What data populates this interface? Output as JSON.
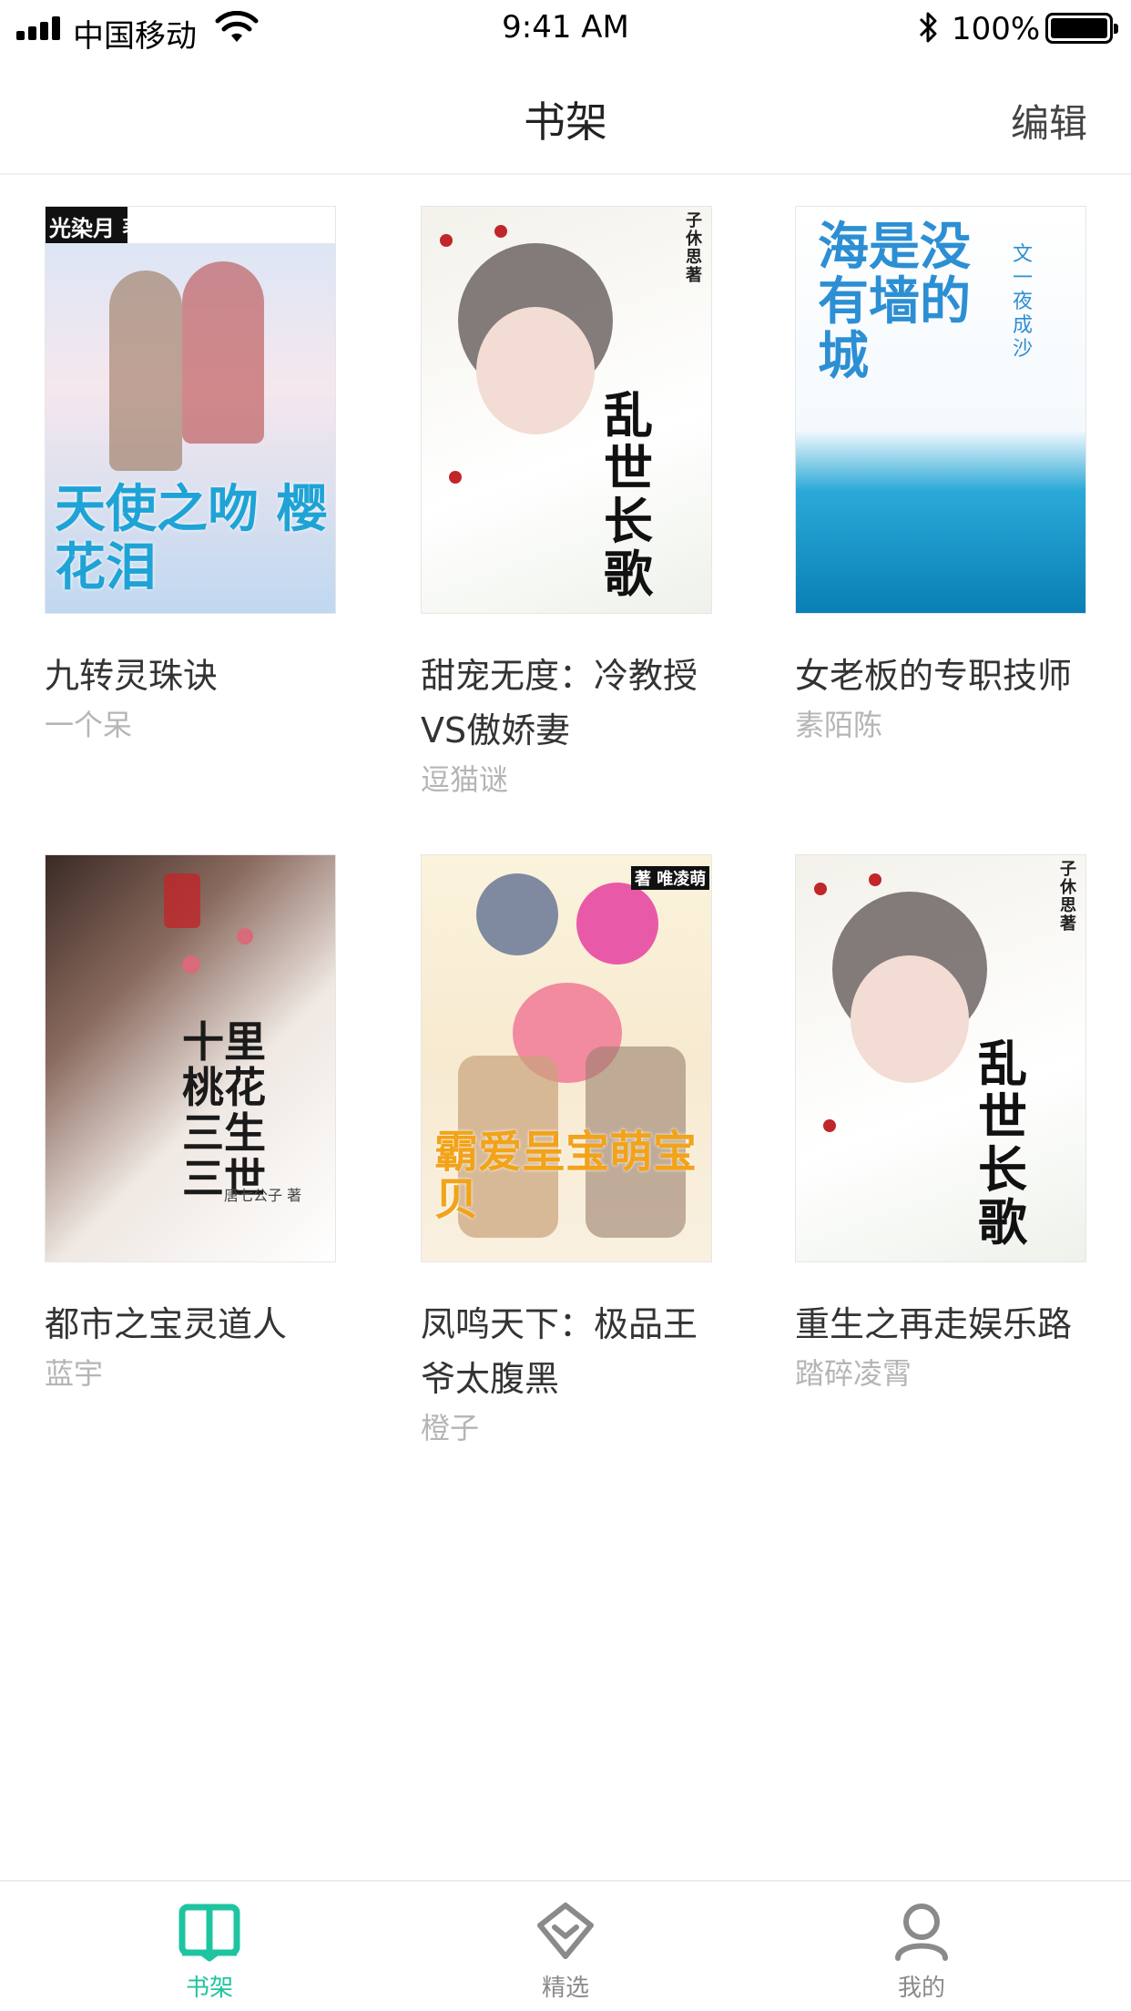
{
  "status_bar": {
    "carrier": "中国移动",
    "time": "9:41 AM",
    "battery": "100%"
  },
  "nav": {
    "title": "书架",
    "edit_label": "编辑"
  },
  "books": [
    {
      "title": "九转灵珠诀",
      "author": "一个呆",
      "cover_text": "天使之吻 樱花泪",
      "cover_author": "光染月 著"
    },
    {
      "title": "甜宠无度：冷教授VS傲娇妻",
      "author": "逗猫谜",
      "cover_text": "乱世长歌",
      "cover_author": "子休思 著"
    },
    {
      "title": "女老板的专职技师",
      "author": "素陌陈",
      "cover_text": "海是没有墙的城",
      "cover_author": "文 一夜成沙"
    },
    {
      "title": "都市之宝灵道人",
      "author": "蓝宇",
      "cover_text": "十里桃花 三生三世",
      "cover_author": "唐七公子 著"
    },
    {
      "title": "凤鸣天下：极品王爷太腹黑",
      "author": "橙子",
      "cover_text": "霸爱呈宝萌宝贝",
      "cover_author": "著 唯凌萌"
    },
    {
      "title": "重生之再走娱乐路",
      "author": "踏碎凌霄",
      "cover_text": "乱世长歌",
      "cover_author": "子休思 著"
    }
  ],
  "tabs": [
    {
      "label": "书架",
      "icon": "book-open-icon",
      "active": true
    },
    {
      "label": "精选",
      "icon": "diamond-icon",
      "active": false
    },
    {
      "label": "我的",
      "icon": "person-icon",
      "active": false
    }
  ],
  "colors": {
    "accent": "#1ec4a0",
    "inactive": "#8a8a8a",
    "author_gray": "#b5b5b5"
  }
}
